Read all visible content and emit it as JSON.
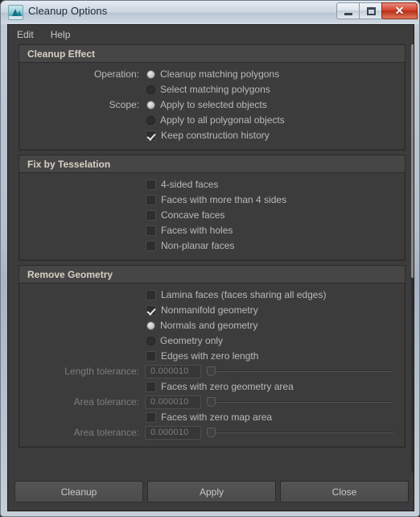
{
  "window": {
    "title": "Cleanup Options",
    "icon": "maya-icon",
    "controls": {
      "minimize": "minimize-icon",
      "maximize": "maximize-icon",
      "close": "✕"
    }
  },
  "menubar": {
    "items": [
      {
        "label": "Edit"
      },
      {
        "label": "Help"
      }
    ]
  },
  "groups": [
    {
      "title": "Cleanup Effect",
      "rows": [
        {
          "label": "Operation:",
          "control": "radio",
          "checked": true,
          "text": "Cleanup matching polygons"
        },
        {
          "label": "",
          "control": "radio",
          "checked": false,
          "text": "Select matching polygons"
        },
        {
          "label": "Scope:",
          "control": "radio",
          "checked": true,
          "text": "Apply to selected objects"
        },
        {
          "label": "",
          "control": "radio",
          "checked": false,
          "text": "Apply to all polygonal objects"
        },
        {
          "label": "",
          "control": "check",
          "checked": true,
          "text": "Keep construction history"
        }
      ]
    },
    {
      "title": "Fix by Tesselation",
      "rows": [
        {
          "label": "",
          "control": "check",
          "checked": false,
          "text": "4-sided faces"
        },
        {
          "label": "",
          "control": "check",
          "checked": false,
          "text": "Faces with more than 4 sides"
        },
        {
          "label": "",
          "control": "check",
          "checked": false,
          "text": "Concave faces"
        },
        {
          "label": "",
          "control": "check",
          "checked": false,
          "text": "Faces with holes"
        },
        {
          "label": "",
          "control": "check",
          "checked": false,
          "text": "Non-planar faces"
        }
      ]
    },
    {
      "title": "Remove Geometry",
      "rows": [
        {
          "label": "",
          "control": "check",
          "checked": false,
          "text": "Lamina faces (faces sharing all edges)"
        },
        {
          "label": "",
          "control": "check",
          "checked": true,
          "text": "Nonmanifold geometry"
        },
        {
          "label": "",
          "control": "radio",
          "checked": true,
          "text": "Normals and geometry"
        },
        {
          "label": "",
          "control": "radio",
          "checked": false,
          "text": "Geometry only"
        },
        {
          "label": "",
          "control": "check",
          "checked": false,
          "text": "Edges with zero length"
        },
        {
          "label": "Length tolerance:",
          "control": "slider",
          "disabled": true,
          "value": "0.000010"
        },
        {
          "label": "",
          "control": "check",
          "checked": false,
          "text": "Faces with zero geometry area"
        },
        {
          "label": "Area tolerance:",
          "control": "slider",
          "disabled": true,
          "value": "0.000010"
        },
        {
          "label": "",
          "control": "check",
          "checked": false,
          "text": "Faces with zero map area"
        },
        {
          "label": "Area tolerance:",
          "control": "slider",
          "disabled": true,
          "value": "0.000010"
        }
      ]
    }
  ],
  "buttons": [
    {
      "label": "Cleanup"
    },
    {
      "label": "Apply"
    },
    {
      "label": "Close"
    }
  ]
}
